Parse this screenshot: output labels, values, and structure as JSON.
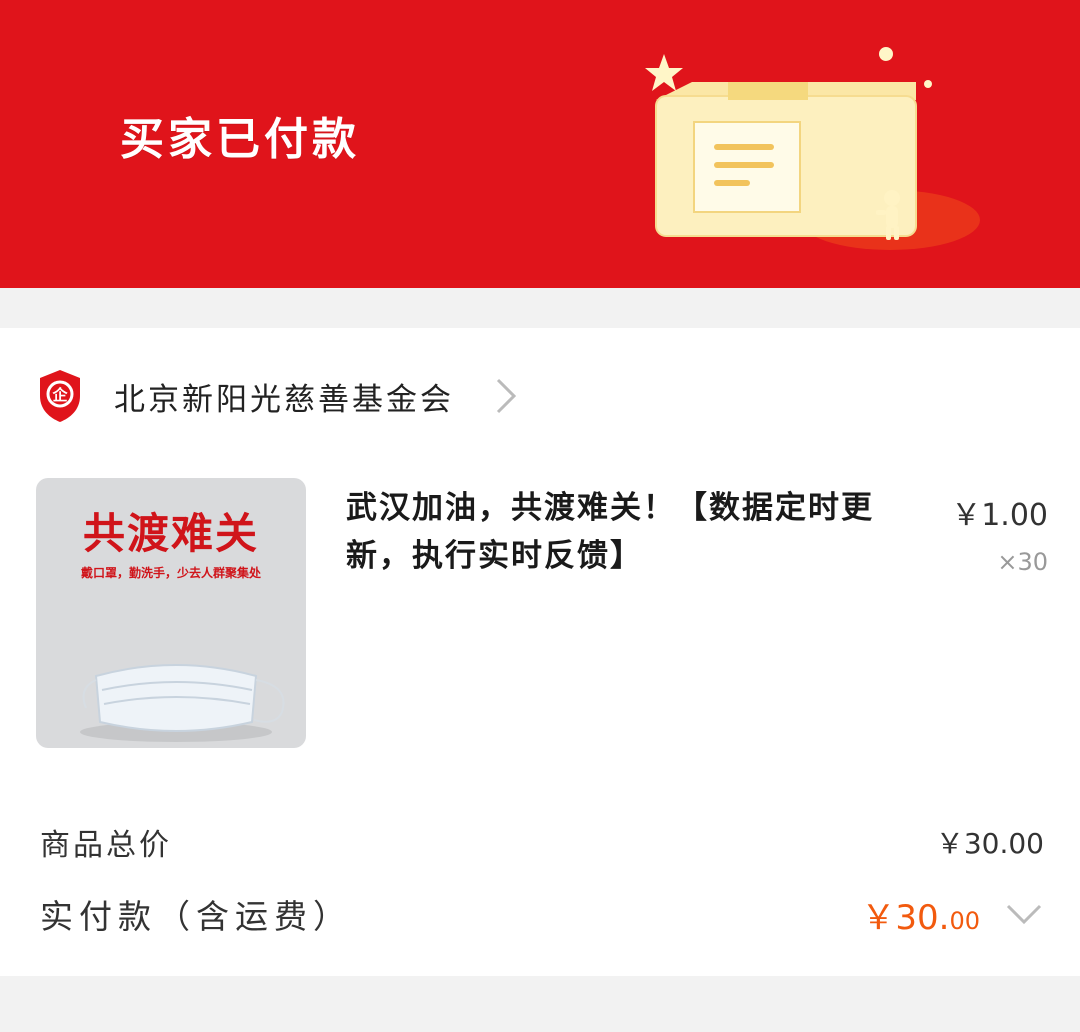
{
  "header": {
    "status_title": "买家已付款",
    "background_color": "#e0141b",
    "illustration_icon": "package-box-icon"
  },
  "seller": {
    "name": "北京新阳光慈善基金会",
    "badge_icon": "enterprise-shield-icon",
    "badge_text": "企",
    "chevron_icon": "chevron-right-icon"
  },
  "product": {
    "thumbnail": {
      "headline": "共渡难关",
      "subline": "戴口罩，勤洗手，少去人群聚集处",
      "image_icon": "face-mask-icon"
    },
    "title": "武汉加油，共渡难关！【数据定时更新，执行实时反馈】",
    "price": "￥1.00",
    "quantity": "×30"
  },
  "summary": {
    "total_label": "商品总价",
    "total_value": "￥30.00",
    "paid_label": "实付款（含运费）",
    "paid_value_main": "￥30.",
    "paid_value_cents": "00",
    "paid_color": "#f25a0e",
    "expand_icon": "chevron-down-icon"
  }
}
